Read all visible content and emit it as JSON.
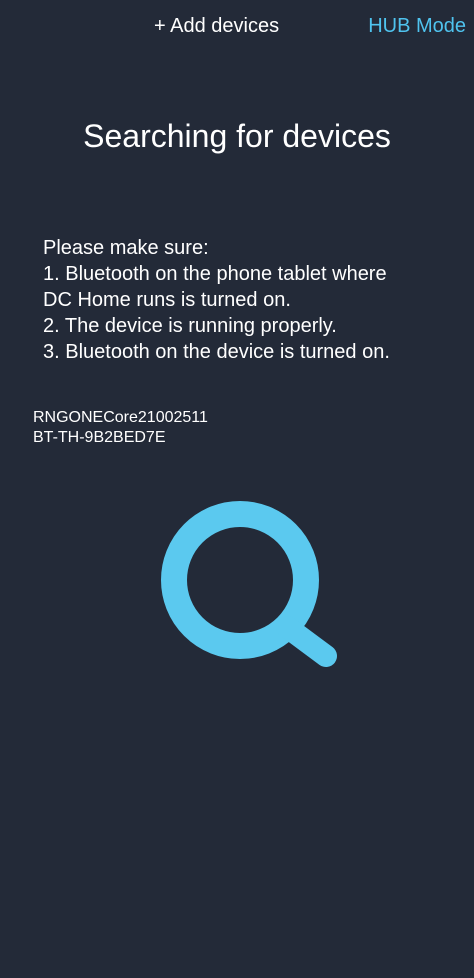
{
  "header": {
    "add_devices_label": "+ Add devices",
    "hub_mode_label": "HUB Mode"
  },
  "main": {
    "title": "Searching for devices",
    "instructions": {
      "intro": "Please make sure:",
      "lines": [
        " 1. Bluetooth on the phone tablet where",
        "DC Home runs is turned on.",
        " 2. The device is running properly.",
        " 3. Bluetooth on the device is turned on."
      ]
    },
    "devices": [
      "RNGONECore21002511",
      "BT-TH-9B2BED7E"
    ]
  },
  "colors": {
    "background": "#232a38",
    "accent": "#4fc3ee",
    "search_icon": "#5bc9ef"
  },
  "icons": {
    "search": "search-icon"
  }
}
